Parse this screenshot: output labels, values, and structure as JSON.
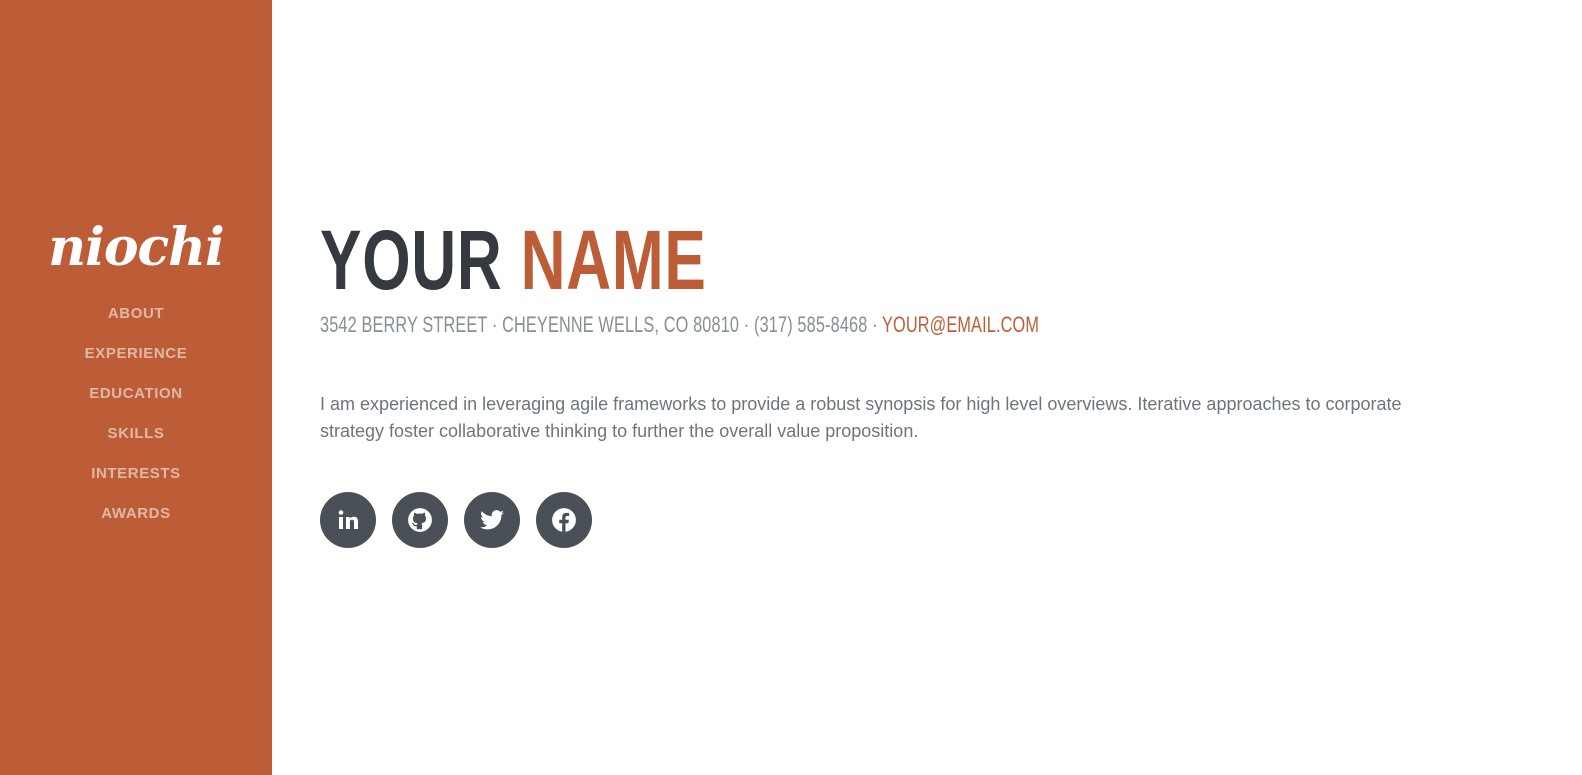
{
  "sidebar": {
    "brand": "niochi",
    "background_color": "#bd5d38",
    "nav": [
      {
        "label": "ABOUT"
      },
      {
        "label": "EXPERIENCE"
      },
      {
        "label": "EDUCATION"
      },
      {
        "label": "SKILLS"
      },
      {
        "label": "INTERESTS"
      },
      {
        "label": "AWARDS"
      }
    ]
  },
  "about": {
    "name_first": "YOUR",
    "name_last": "NAME",
    "address": "3542 BERRY STREET · CHEYENNE WELLS, CO 80810 · (317) 585-8468 · ",
    "email": "YOUR@EMAIL.COM",
    "lead": "I am experienced in leveraging agile frameworks to provide a robust synopsis for high level overviews. Iterative approaches to corporate strategy foster collaborative thinking to further the overall value proposition."
  },
  "social": [
    {
      "icon": "linkedin-icon"
    },
    {
      "icon": "github-icon"
    },
    {
      "icon": "twitter-icon"
    },
    {
      "icon": "facebook-icon"
    }
  ],
  "colors": {
    "accent": "#bd5d38",
    "heading": "#343a40",
    "muted": "#868e96",
    "social_bg": "#495057"
  }
}
